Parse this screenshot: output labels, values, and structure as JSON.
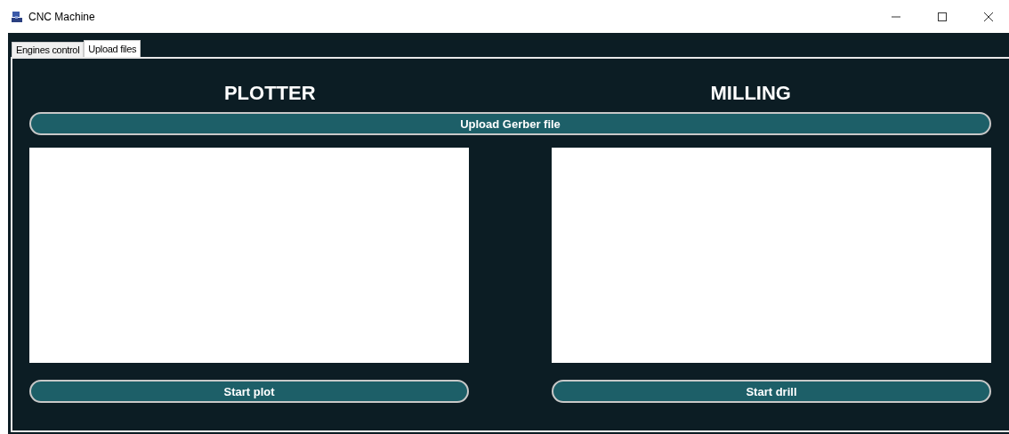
{
  "window": {
    "title": "CNC Machine"
  },
  "tabs": [
    {
      "label": "Engines control",
      "selected": false
    },
    {
      "label": "Upload files",
      "selected": true
    }
  ],
  "sections": [
    {
      "title": "PLOTTER",
      "button": "Start plot"
    },
    {
      "title": "MILLING",
      "button": "Start drill"
    }
  ],
  "upload_button": "Upload Gerber file"
}
